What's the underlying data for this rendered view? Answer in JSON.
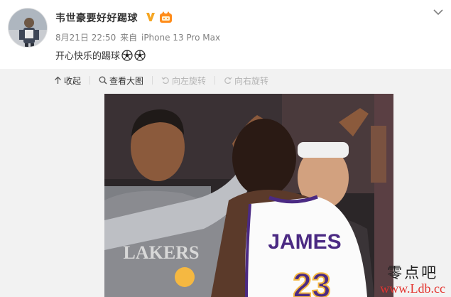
{
  "post": {
    "username": "韦世豪要好好踢球",
    "badges": [
      "vip-v-badge",
      "member-badge"
    ],
    "date": "8月21日 22:50",
    "source_prefix": "来自",
    "source_device": "iPhone 13 Pro Max",
    "text": "开心快乐的踢球",
    "emojis": [
      "soccer-ball",
      "soccer-ball"
    ]
  },
  "toolbar": {
    "collapse_label": "收起",
    "view_large_label": "查看大图",
    "rotate_left_label": "向左旋转",
    "rotate_right_label": "向右旋转"
  },
  "photo": {
    "jersey_name": "JAMES",
    "jersey_number": "23",
    "shirt_text": "LAKERS"
  },
  "watermark": {
    "site_cn": "零点吧",
    "site_url": "www.Ldb.cc"
  },
  "colors": {
    "meta_gray": "#808080",
    "panel_bg": "#f2f2f2",
    "vip_orange": "#f5a623",
    "lakers_purple": "#4b2a83",
    "lakers_gold": "#f5b841",
    "watermark_red": "#e3342f"
  }
}
